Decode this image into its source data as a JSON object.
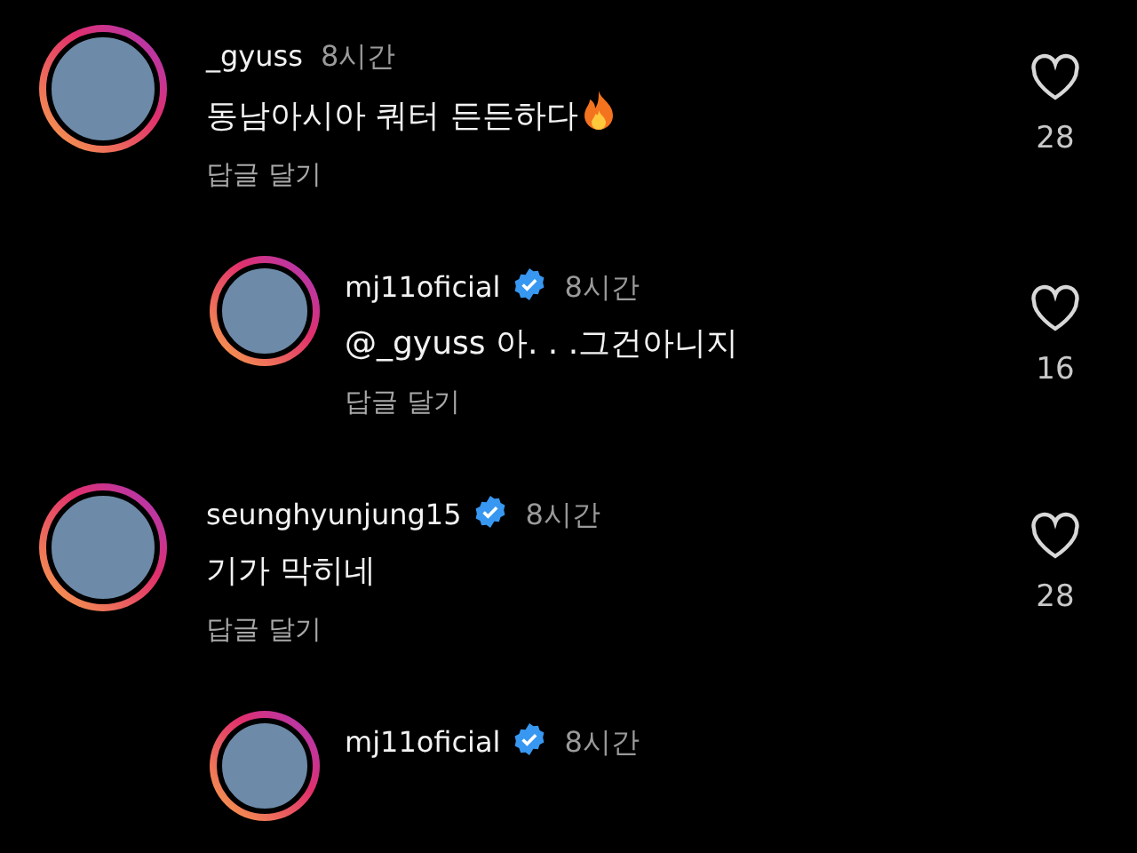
{
  "comments": [
    {
      "username": "_gyuss",
      "verified": false,
      "time": "8시간",
      "text": "동남아시아 쿼터 든든하다",
      "fire_icon": true,
      "reply_label": "답글 달기",
      "likes": "28",
      "story_ring": true,
      "replies": [
        {
          "username": "mj11oficial",
          "verified": true,
          "time": "8시간",
          "text": "@_gyuss 아. . .그건아니지",
          "fire_icon": false,
          "reply_label": "답글 달기",
          "likes": "16",
          "story_ring": true
        }
      ]
    },
    {
      "username": "seunghyunjung15",
      "verified": true,
      "time": "8시간",
      "text": "기가 막히네",
      "fire_icon": false,
      "reply_label": "답글 달기",
      "likes": "28",
      "story_ring": true,
      "replies": [
        {
          "username": "mj11oficial",
          "verified": true,
          "time": "8시간",
          "story_ring": true
        }
      ]
    }
  ]
}
